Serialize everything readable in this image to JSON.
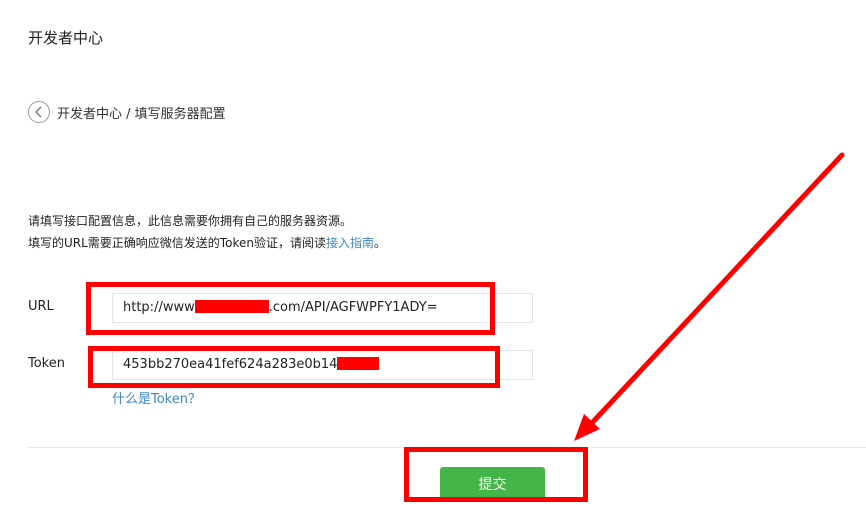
{
  "header": {
    "title": "开发者中心"
  },
  "breadcrumb": {
    "text": "开发者中心 / 填写服务器配置"
  },
  "intro": {
    "line1": "请填写接口配置信息，此信息需要你拥有自己的服务器资源。",
    "line2_prefix": "填写的URL需要正确响应微信发送的Token验证，请阅读",
    "line2_link": "接入指南",
    "line2_suffix": "。"
  },
  "form": {
    "url": {
      "label": "URL",
      "value_prefix": "http://www",
      "value_suffix": ".com/API/AGFWPFY1ADY="
    },
    "token": {
      "label": "Token",
      "value": "453bb270ea41fef624a283e0b14",
      "help_link": "什么是Token？"
    }
  },
  "actions": {
    "submit_label": "提交"
  },
  "colors": {
    "annotation_red": "#ff0000",
    "link_blue": "#3d86c6",
    "submit_green": "#44b549"
  }
}
